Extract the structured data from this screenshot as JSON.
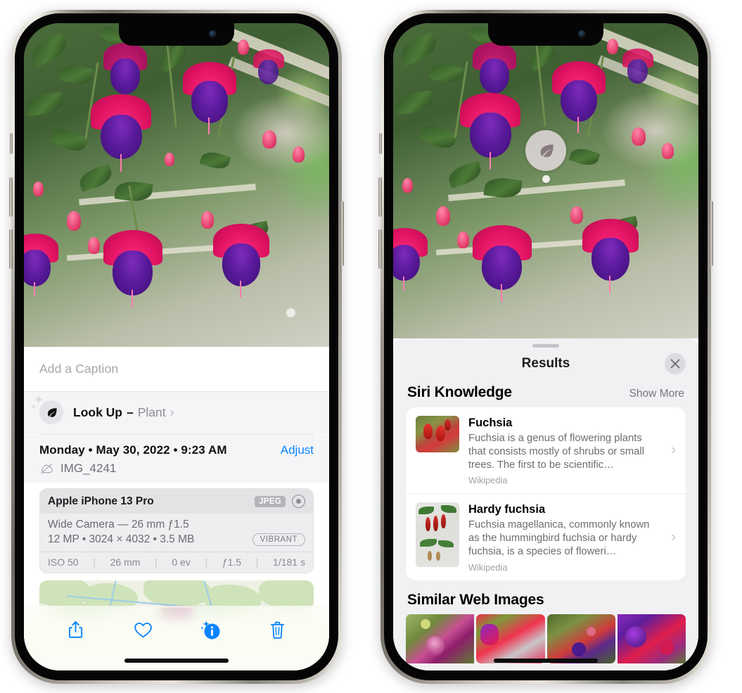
{
  "app": {
    "name": "Photos",
    "platform": "iOS"
  },
  "left_phone": {
    "caption": {
      "placeholder": "Add a Caption",
      "value": ""
    },
    "lookup": {
      "icon": "leaf-icon",
      "label": "Look Up",
      "dash": "–",
      "subject": "Plant",
      "chevron": "›"
    },
    "meta": {
      "date": "Monday • May 30, 2022 • 9:23 AM",
      "adjust_label": "Adjust",
      "cloud_icon": "cloud-slash-icon",
      "filename": "IMG_4241"
    },
    "camera_card": {
      "device": "Apple iPhone 13 Pro",
      "format_tag": "JPEG",
      "raw_icon": "aperture-icon",
      "lens_line": "Wide Camera — 26 mm ƒ1.5",
      "size_line": "12 MP • 3024 × 4032 • 3.5 MB",
      "style_tag": "VIBRANT",
      "exif": [
        "ISO 50",
        "26 mm",
        "0 ev",
        "ƒ1.5",
        "1/181 s"
      ]
    },
    "toolbar": [
      {
        "name": "share-icon",
        "label": "Share"
      },
      {
        "name": "heart-icon",
        "label": "Favorite"
      },
      {
        "name": "info-sparkle-icon",
        "label": "Info"
      },
      {
        "name": "trash-icon",
        "label": "Delete"
      }
    ]
  },
  "right_phone": {
    "visual_lookup_pin": {
      "icon": "leaf-icon"
    },
    "panel": {
      "title": "Results",
      "close_icon": "close-icon",
      "sections": [
        {
          "title": "Siri Knowledge",
          "action": "Show More",
          "entries": [
            {
              "title": "Fuchsia",
              "description": "Fuchsia is a genus of flowering plants that consists mostly of shrubs or small trees. The first to be scientific…",
              "source": "Wikipedia",
              "chevron": "›"
            },
            {
              "title": "Hardy fuchsia",
              "description": "Fuchsia magellanica, commonly known as the hummingbird fuchsia or hardy fuchsia, is a species of floweri…",
              "source": "Wikipedia",
              "chevron": "›"
            }
          ]
        },
        {
          "title": "Similar Web Images",
          "tiles": [
            "web-image-1",
            "web-image-2",
            "web-image-3",
            "web-image-4"
          ]
        }
      ]
    }
  },
  "colors": {
    "accent_blue": "#0a84ff",
    "panel_bg": "#f1f1f4",
    "card_bg": "#ffffff",
    "secondary_text": "#6d6d73",
    "tertiary_text": "#a2a2a8"
  }
}
